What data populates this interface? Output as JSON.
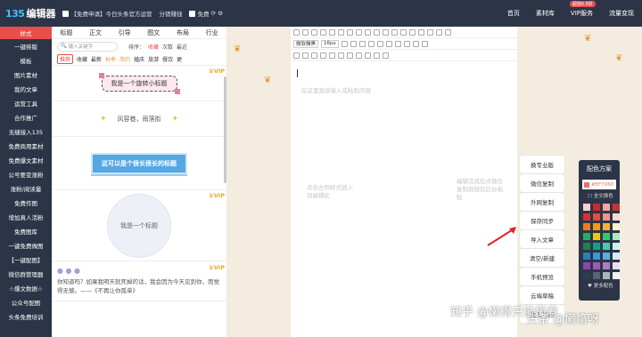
{
  "topbar": {
    "logo_mark": "135",
    "logo_text": "编辑器",
    "promo": "【免费申请】今日头条官方运营",
    "affiliate": "分销赚钱",
    "free_label": "免费",
    "nav": [
      "首页",
      "素材库",
      "VIP服务",
      "流量变现"
    ],
    "vip_badge": "超值6.8折"
  },
  "sidebar": {
    "items": [
      "样式",
      "一键排版",
      "模板",
      "图片素材",
      "我的文章",
      "运营工具",
      "合作推广",
      "无缝接入135",
      "免费商用素材",
      "免费爆文素材",
      "公号要变涨粉",
      "涨粉/阅读量",
      "免费作图",
      "增加真人活粉",
      "免费图库",
      "一键免费做图",
      "【一键配图】",
      "微信群管理器",
      "☆爆文数据☆",
      "公众号配图",
      "头条免费培训"
    ]
  },
  "panel": {
    "tabs": [
      "标题",
      "正文",
      "引导",
      "图文",
      "布局",
      "行业"
    ],
    "search_placeholder": "输入关键字",
    "sort_label": "排序：",
    "sort_options": [
      "收藏",
      "次数",
      "最近"
    ],
    "filters": [
      "推荐",
      "收藏",
      "最新",
      "秋季",
      "简约",
      "婚庆",
      "旅游",
      "餐饮",
      "更"
    ],
    "vip_label": "VIP"
  },
  "templates": {
    "t1": "我是一个旋转小标题",
    "t2": "风容巷，雨落街",
    "t3": "这可以是个很长很长的标题",
    "t4": "我是一个标题",
    "t5": "你知道吗？如果我明天就死掉的话，我会因为今天见到你，而觉得无憾。——《不再让你孤单》"
  },
  "editor": {
    "font": "微软雅黑",
    "size": "16px",
    "placeholder": "在这里直接输入或粘贴内容",
    "left_hint": "点击左侧样式插入到编辑区",
    "right_hint": "编辑完成后点微信复制到微信后台粘贴"
  },
  "actions": [
    "换专业版",
    "微信复制",
    "外网复制",
    "保存同步",
    "导入文章",
    "清空/新建",
    "手机预览",
    "云端草稿",
    "生成长图"
  ],
  "palette": {
    "title": "配色方案",
    "current": "#EF7060",
    "all_label": "全文换色",
    "more_label": "更多配色",
    "colors": [
      "#f9cfd6",
      "#c92a2a",
      "#f3a7a0",
      "#c0392b",
      "#d63031",
      "#e74c3c",
      "#f1948a",
      "#fadbd8",
      "#e67e22",
      "#f39c12",
      "#f5b041",
      "#fcf3cf",
      "#27ae60",
      "#f1c40f",
      "#2ecc71",
      "#abebc6",
      "#1e8449",
      "#16a085",
      "#48c9b0",
      "#d1f2eb",
      "#2980b9",
      "#3498db",
      "#5dade2",
      "#d6eaf8",
      "#8e44ad",
      "#9b59b6",
      "#af7ac5",
      "#ebdef0",
      "#2c3e50",
      "#566573",
      "#aab7b8",
      "#f2f3f4"
    ]
  },
  "watermark": {
    "zhihu": "知乎 @懒得只能懒着",
    "toutiao": "头条 @懒惰呀"
  }
}
